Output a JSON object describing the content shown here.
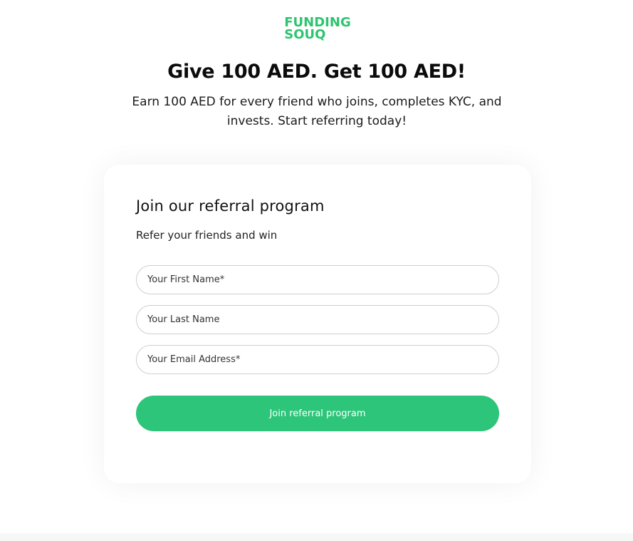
{
  "brand": {
    "logo_line1": "FUNDING",
    "logo_line2": "SOUQ",
    "accent_color": "#2dc46f"
  },
  "hero": {
    "headline": "Give 100 AED. Get 100 AED!",
    "subheadline": "Earn 100 AED for every friend who joins, completes KYC, and invests. Start referring today!"
  },
  "form": {
    "title": "Join our referral program",
    "subtitle": "Refer your friends and win",
    "first_name_placeholder": "Your First Name*",
    "last_name_placeholder": "Your Last Name",
    "email_placeholder": "Your Email Address*",
    "submit_label": "Join referral program",
    "button_color": "#2dc57a"
  }
}
